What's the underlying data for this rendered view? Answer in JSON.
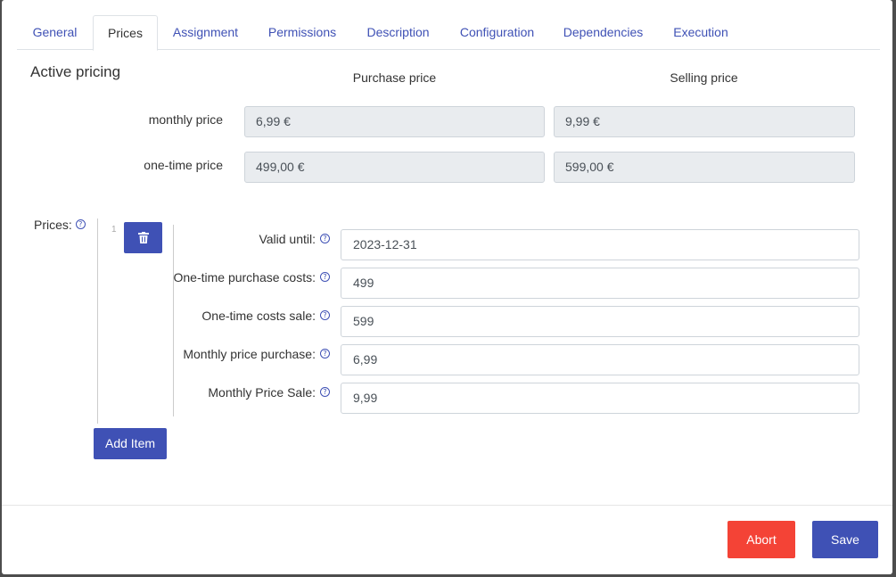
{
  "tabs": [
    {
      "label": "General"
    },
    {
      "label": "Prices"
    },
    {
      "label": "Assignment"
    },
    {
      "label": "Permissions"
    },
    {
      "label": "Description"
    },
    {
      "label": "Configuration"
    },
    {
      "label": "Dependencies"
    },
    {
      "label": "Execution"
    }
  ],
  "active_tab": "Prices",
  "active_pricing": {
    "title": "Active pricing",
    "purchase_header": "Purchase price",
    "selling_header": "Selling price",
    "rows": [
      {
        "label": "monthly price",
        "purchase": "6,99 €",
        "selling": "9,99 €"
      },
      {
        "label": "one-time price",
        "purchase": "499,00 €",
        "selling": "599,00 €"
      }
    ]
  },
  "prices": {
    "label": "Prices:",
    "item_index": "1",
    "fields": [
      {
        "label": "Valid until:",
        "value": "2023-12-31"
      },
      {
        "label": "One-time purchase costs:",
        "value": "499"
      },
      {
        "label": "One-time costs sale:",
        "value": "599"
      },
      {
        "label": "Monthly price purchase:",
        "value": "6,99"
      },
      {
        "label": "Monthly Price Sale:",
        "value": "9,99"
      }
    ],
    "add_item_label": "Add Item"
  },
  "footer": {
    "abort_label": "Abort",
    "save_label": "Save"
  },
  "colors": {
    "primary": "#3f51b5",
    "danger": "#f44336"
  },
  "icons": {
    "help": "question-circle-icon",
    "delete": "trash-icon"
  }
}
